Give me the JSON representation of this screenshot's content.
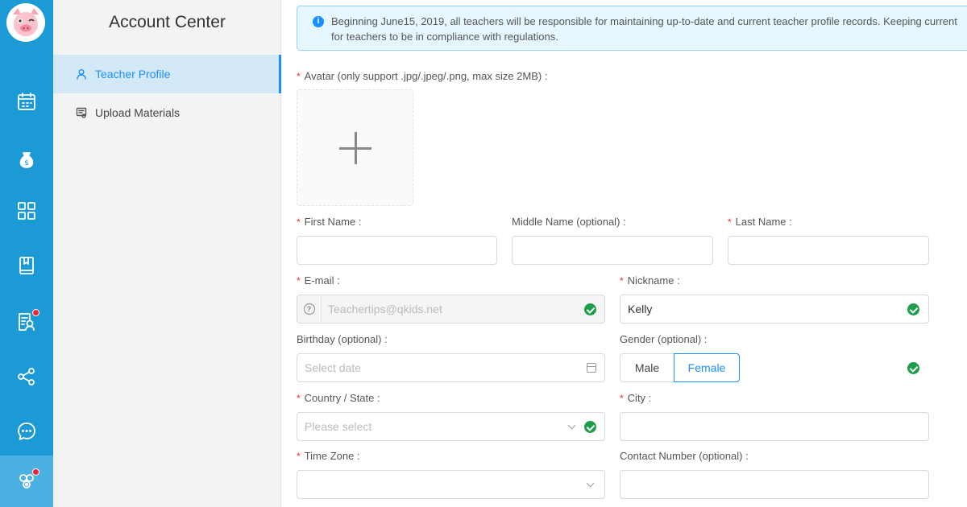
{
  "sidebar": {
    "title": "Account Center",
    "items": [
      {
        "label": "Teacher Profile"
      },
      {
        "label": "Upload Materials"
      }
    ]
  },
  "alert": {
    "line1": "Beginning June15, 2019, all teachers will be responsible for maintaining up-to-date and current teacher profile records. Keeping current",
    "line2": "for teachers to be in compliance with regulations."
  },
  "form": {
    "avatar_label": "Avatar (only support .jpg/.jpeg/.png, max size 2MB) :",
    "first_name_label": "First Name :",
    "middle_name_label": "Middle Name (optional) :",
    "last_name_label": "Last Name :",
    "email_label": "E-mail :",
    "email_value": "Teachertips@qkids.net",
    "nickname_label": "Nickname :",
    "nickname_value": "Kelly",
    "birthday_label": "Birthday (optional) :",
    "birthday_placeholder": "Select date",
    "gender_label": "Gender (optional) :",
    "gender_options": [
      "Male",
      "Female"
    ],
    "gender_selected": "Female",
    "country_label": "Country / State :",
    "country_placeholder": "Please select",
    "city_label": "City :",
    "timezone_label": "Time Zone :",
    "contact_label": "Contact Number (optional) :",
    "required_mark": "*",
    "help_glyph": "?",
    "plus_glyph": "+"
  },
  "icons": {
    "rail": [
      "calendar-icon",
      "money-bag-icon",
      "grid-icon",
      "book-icon",
      "certificate-icon",
      "share-icon",
      "chat-icon",
      "settings-icon"
    ],
    "accent": "#1b9ad6",
    "check": "#1e9e4a",
    "badge": "#f5222d"
  }
}
